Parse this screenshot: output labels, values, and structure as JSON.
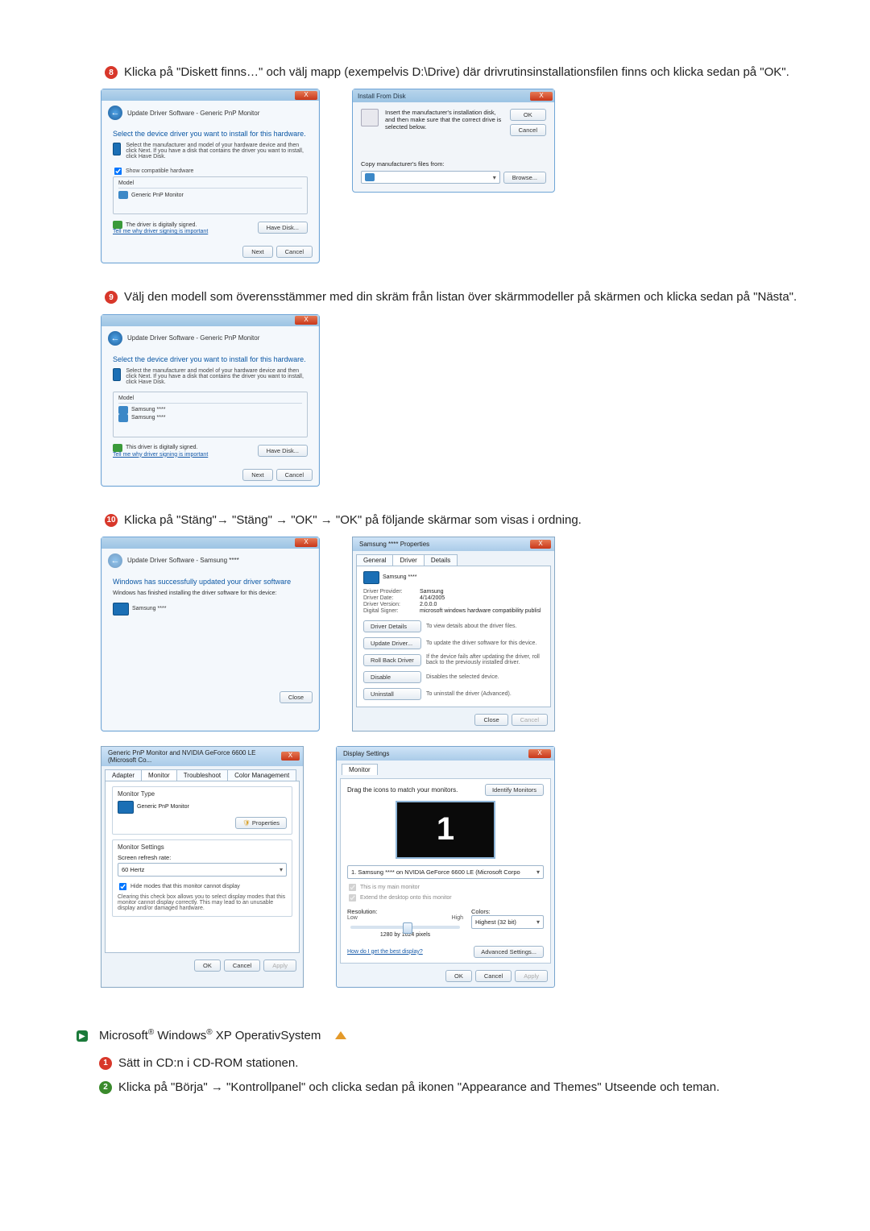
{
  "step8": {
    "num": "8",
    "text": "Klicka på \"Diskett finns…\" och välj mapp (exempelvis D:\\Drive) där drivrutinsinstallationsfilen finns och klicka sedan på \"OK\".",
    "dlgA": {
      "crumb": "Update Driver Software - Generic PnP Monitor",
      "heading": "Select the device driver you want to install for this hardware.",
      "hint": "Select the manufacturer and model of your hardware device and then click Next. If you have a disk that contains the driver you want to install, click Have Disk.",
      "chk": "Show compatible hardware",
      "colModel": "Model",
      "item": "Generic PnP Monitor",
      "signed": "The driver is digitally signed.",
      "signedLink": "Tell me why driver signing is important",
      "haveDisk": "Have Disk...",
      "next": "Next",
      "cancel": "Cancel"
    },
    "dlgB": {
      "title": "Install From Disk",
      "msg": "Insert the manufacturer's installation disk, and then make sure that the correct drive is selected below.",
      "ok": "OK",
      "cancel": "Cancel",
      "copy": "Copy manufacturer's files from:",
      "browse": "Browse..."
    }
  },
  "step9": {
    "num": "9",
    "text": "Välj den modell som överensstämmer med din skräm från listan över skärmmodeller på skärmen och klicka sedan på \"Nästa\".",
    "dlg": {
      "crumb": "Update Driver Software - Generic PnP Monitor",
      "heading": "Select the device driver you want to install for this hardware.",
      "hint": "Select the manufacturer and model of your hardware device and then click Next. If you have a disk that contains the driver you want to install, click Have Disk.",
      "colModel": "Model",
      "item1": "Samsung ****",
      "item2": "Samsung ****",
      "signed": "This driver is digitally signed.",
      "signedLink": "Tell me why driver signing is important",
      "haveDisk": "Have Disk...",
      "next": "Next",
      "cancel": "Cancel"
    }
  },
  "step10": {
    "num": "10",
    "text": "Klicka på \"Stäng\"→ \"Stäng\" → \"OK\" → \"OK\" på följande skärmar som visas i ordning.",
    "dlgA": {
      "crumb": "Update Driver Software - Samsung ****",
      "heading": "Windows has successfully updated your driver software",
      "sub": "Windows has finished installing the driver software for this device:",
      "item": "Samsung ****",
      "close": "Close"
    },
    "dlgB": {
      "title": "Samsung **** Properties",
      "tabs": [
        "General",
        "Driver",
        "Details"
      ],
      "dev": "Samsung ****",
      "rows": {
        "prov": "Driver Provider:",
        "provV": "Samsung",
        "date": "Driver Date:",
        "dateV": "4/14/2005",
        "ver": "Driver Version:",
        "verV": "2.0.0.0",
        "sig": "Digital Signer:",
        "sigV": "microsoft windows hardware compatibility publisl"
      },
      "actions": {
        "details": {
          "btn": "Driver Details",
          "desc": "To view details about the driver files."
        },
        "update": {
          "btn": "Update Driver...",
          "desc": "To update the driver software for this device."
        },
        "rollback": {
          "btn": "Roll Back Driver",
          "desc": "If the device fails after updating the driver, roll back to the previously installed driver."
        },
        "disable": {
          "btn": "Disable",
          "desc": "Disables the selected device."
        },
        "uninstall": {
          "btn": "Uninstall",
          "desc": "To uninstall the driver (Advanced)."
        }
      },
      "close": "Close",
      "cancel": "Cancel"
    },
    "dlgC": {
      "title": "Generic PnP Monitor and NVIDIA GeForce 6600 LE (Microsoft Co...",
      "tabs": [
        "Adapter",
        "Monitor",
        "Troubleshoot",
        "Color Management"
      ],
      "monitorType": "Monitor Type",
      "monitorName": "Generic PnP Monitor",
      "properties": "Properties",
      "settings": "Monitor Settings",
      "refresh": "Screen refresh rate:",
      "hz": "60 Hertz",
      "hideChk": "Hide modes that this monitor cannot display",
      "hideDesc": "Clearing this check box allows you to select display modes that this monitor cannot display correctly. This may lead to an unusable display and/or damaged hardware.",
      "ok": "OK",
      "cancel": "Cancel",
      "apply": "Apply"
    },
    "dlgD": {
      "title": "Display Settings",
      "tab": "Monitor",
      "drag": "Drag the icons to match your monitors.",
      "identify": "Identify Monitors",
      "monNum": "1",
      "device": "1. Samsung **** on NVIDIA GeForce 6600 LE (Microsoft Corpo",
      "chkMain": "This is my main monitor",
      "chkExtend": "Extend the desktop onto this monitor",
      "res": "Resolution:",
      "low": "Low",
      "high": "High",
      "resVal": "1280 by 1024 pixels",
      "colors": "Colors:",
      "colorVal": "Highest (32 bit)",
      "help": "How do I get the best display?",
      "adv": "Advanced Settings...",
      "ok": "OK",
      "cancel": "Cancel",
      "apply": "Apply"
    }
  },
  "xp": {
    "title_pre": "Microsoft",
    "title_mid": " Windows",
    "title_post": " XP OperativSystem",
    "s1": {
      "num": "1",
      "text": "Sätt in CD:n i CD-ROM stationen."
    },
    "s2": {
      "num": "2",
      "text": "Klicka på \"Börja\" → \"Kontrollpanel\" och clicka sedan på ikonen \"Appearance and Themes\" Utseende och teman."
    }
  }
}
